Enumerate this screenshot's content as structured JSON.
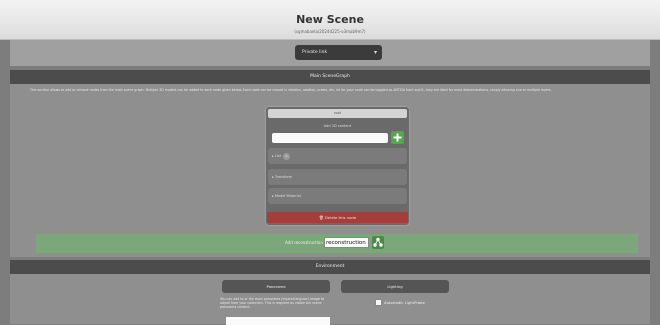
{
  "header": {
    "title": "New Scene",
    "subtitle": "(sgmabaela/2024d225-o3mab9m7)"
  },
  "privacy": {
    "selected": "Private link"
  },
  "scenegraph": {
    "section_title": "Main SceneGraph",
    "description": "This section allows to add or remove nodes from the main scene graph. Multiple 3D models can be added to each node given below. Each node can be moved in rotation, rotation, scales, etc. ml for your node can be toggled as ANTSIA front and it, they are ideal for most demonstrations, simply allowing one or multiple layers.",
    "node": {
      "title": "root",
      "child_label": "Add 3D content",
      "child_input_value": "",
      "list_label": "List",
      "list_count": "0",
      "transform_label": "Transform",
      "model_label": "Model Material",
      "delete_label": "Delete this node"
    },
    "reconstruction": {
      "label": "Add reconstruction",
      "value": "reconstruction"
    }
  },
  "environment": {
    "section_title": "Environment",
    "panorama_label": "Panorama",
    "lighting_label": "Lighting",
    "panorama_text": "You can add to or the main panorama (equirectangular) image to adjust from your collection. This is required as visible the scene panorama content.",
    "auto_light_label": "Automatic LightProbe"
  },
  "colors": {
    "add_green": "#51a94a",
    "delete_red": "#a33e3a",
    "reconstruction_bar": "#7ba77a",
    "section_bar": "#4c4c4c"
  }
}
